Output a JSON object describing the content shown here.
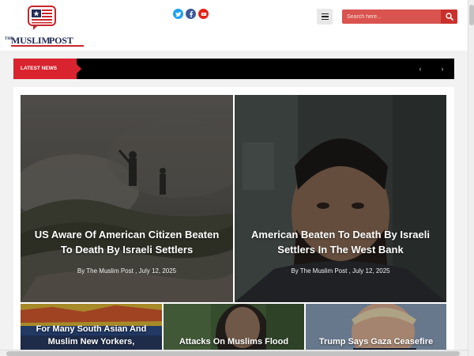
{
  "header": {
    "logo": {
      "the": "THE",
      "muslim": "MUSLIM",
      "post": "POST"
    },
    "social": [
      {
        "name": "twitter-icon",
        "color": "#1da1f2"
      },
      {
        "name": "facebook-icon",
        "color": "#3b5998"
      },
      {
        "name": "youtube-icon",
        "color": "#e62117"
      }
    ],
    "menu_icon": "hamburger-icon",
    "search": {
      "placeholder": "Search here...",
      "icon": "search-icon"
    }
  },
  "ticker": {
    "label": "LATEST NEWS",
    "prev": "‹",
    "next": "›"
  },
  "articles": [
    {
      "title": "US Aware Of American Citizen Beaten To Death By Israeli Settlers",
      "byline": "By",
      "author": "The Muslim Post",
      "date": ", July 12, 2025"
    },
    {
      "title": "American Beaten To Death By Israeli Settlers In The West Bank",
      "byline": "By",
      "author": "The Muslim Post",
      "date": ", July 12, 2025"
    },
    {
      "title": "For Many South Asian And Muslim New Yorkers,"
    },
    {
      "title": "Attacks On Muslims Flood"
    },
    {
      "title": "Trump Says Gaza Ceasefire"
    }
  ],
  "colors": {
    "accent": "#d9232e",
    "search_bg": "#d9534f",
    "ticker_bg": "#000000",
    "logo_navy": "#1f2a55"
  }
}
